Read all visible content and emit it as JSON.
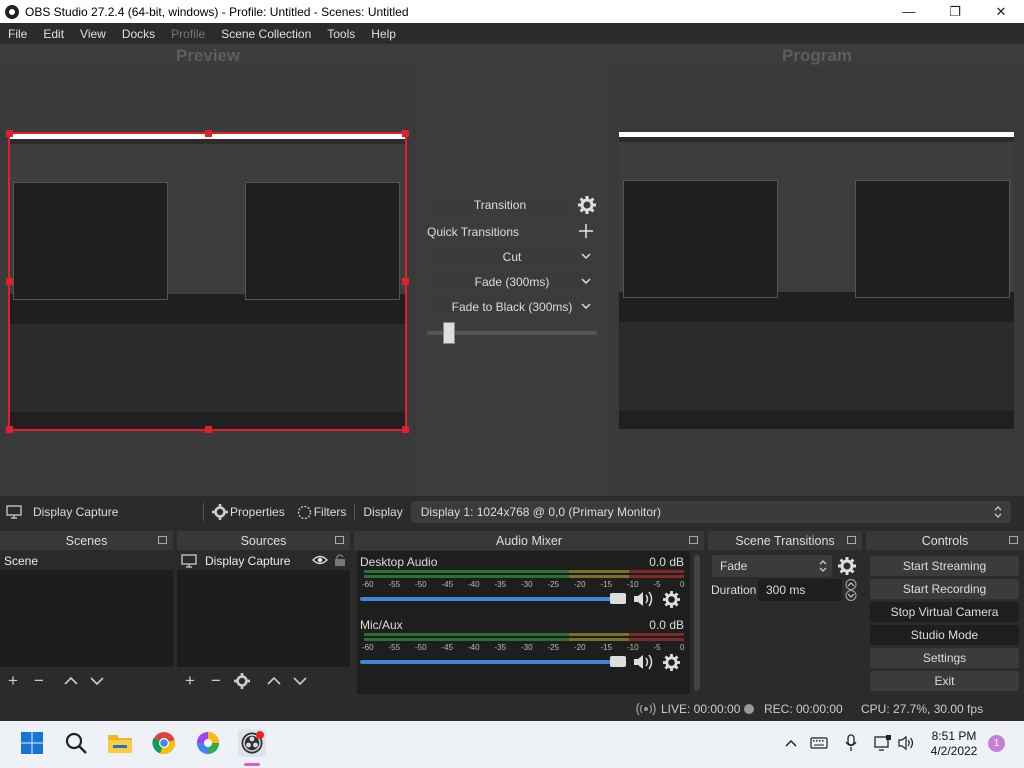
{
  "window": {
    "title": "OBS Studio 27.2.4 (64-bit, windows) - Profile: Untitled - Scenes: Untitled"
  },
  "menu": [
    "File",
    "Edit",
    "View",
    "Docks",
    "Profile",
    "Scene Collection",
    "Tools",
    "Help"
  ],
  "canvas": {
    "preview_label": "Preview",
    "program_label": "Program"
  },
  "transition_panel": {
    "transition_button": "Transition",
    "quick_transitions_label": "Quick Transitions",
    "items": [
      "Cut",
      "Fade (300ms)",
      "Fade to Black (300ms)"
    ],
    "tbar_level": 0.1
  },
  "source_toolbar": {
    "source_name": "Display Capture",
    "properties": "Properties",
    "filters": "Filters",
    "display_label": "Display",
    "display_value": "Display 1: 1024x768 @ 0,0 (Primary Monitor)"
  },
  "scenes": {
    "title": "Scenes",
    "items": [
      "Scene"
    ]
  },
  "sources": {
    "title": "Sources",
    "items": [
      "Display Capture"
    ]
  },
  "audio_mixer": {
    "title": "Audio Mixer",
    "channels": [
      {
        "name": "Desktop Audio",
        "db": "0.0 dB",
        "volume": 1.0
      },
      {
        "name": "Mic/Aux",
        "db": "0.0 dB",
        "volume": 1.0
      }
    ],
    "scale": [
      "-60",
      "-55",
      "-50",
      "-45",
      "-40",
      "-35",
      "-30",
      "-25",
      "-20",
      "-15",
      "-10",
      "-5",
      "0"
    ]
  },
  "scene_transitions": {
    "title": "Scene Transitions",
    "selected": "Fade",
    "duration_label": "Duration",
    "duration_value": "300 ms"
  },
  "controls": {
    "title": "Controls",
    "buttons": [
      "Start Streaming",
      "Start Recording",
      "Stop Virtual Camera",
      "Studio Mode",
      "Settings",
      "Exit"
    ]
  },
  "status": {
    "live": "LIVE: 00:00:00",
    "rec": "REC: 00:00:00",
    "cpu": "CPU: 27.7%, 30.00 fps"
  },
  "taskbar": {
    "time": "8:51 PM",
    "date": "4/2/2022",
    "notifications": "1"
  },
  "colors": {
    "accent_red": "#e0202a",
    "slider_blue": "#3d86d8",
    "meter_green": "#3ab54a",
    "meter_yellow": "#c8b83a",
    "meter_red": "#c8463a"
  }
}
